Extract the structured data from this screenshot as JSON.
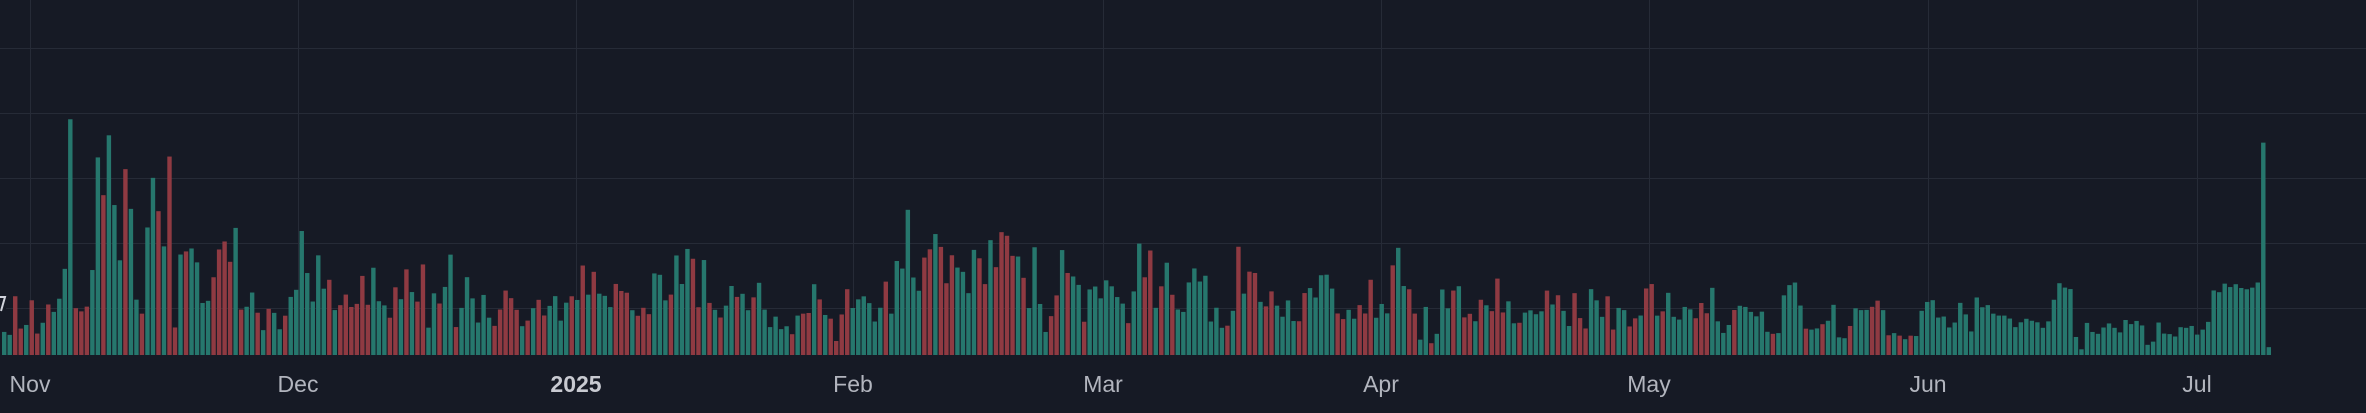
{
  "chart_data": {
    "type": "bar",
    "title": "",
    "xlabel": "",
    "ylabel": "",
    "grid": true,
    "legend": "none",
    "ylim": [
      0,
      100
    ],
    "x_ticks": [
      "Nov",
      "Dec",
      "2025",
      "Feb",
      "Mar",
      "Apr",
      "May",
      "Jun",
      "Jul"
    ],
    "bold_ticks": [
      "2025"
    ],
    "colors": {
      "up": "#26776d",
      "down": "#8f3a42",
      "background": "#161a25",
      "grid": "#262b37",
      "tick_text": "#b2b5be"
    },
    "directions": "UUDDUDDUDUUUUDDDUUDUUUDUUDUUDUDDUDUUUUDDDDUDUUDUDUUDUUUUUUUDUDDDDDDUUUDDUDUDDUUDUUDUUUUUUDDDDDUDUDDUUUUDUDUDUUUDDDUDDDUUUDUUUDDUDUDUUDUUDUUUUUUDUDDUDUDDDDUUUUUUDUUUUUUDDUDDDUUUUDDUDDDDUDUUUUDDUDUUDUUUUUUUDUUDDUDUDUUUUUUUUUDUDUDDUDDUUUUDDUUUUUDDUUDDDUUUDUUDDUUDUUUDUDDUDUDDDUUDUUUUDUDUUDDDUUUDDUUDDUDDUDUUUUUDDDUUUUDUUUUUUDUUUUUDUUDUUUUDUUUDDUDUDUDU",
    "values": [
      6.89,
      6.01,
      17.54,
      7.89,
      8.97,
      16.33,
      6.4,
      9.62,
      15.08,
      12.87,
      16.8,
      25.72,
      70.37,
      13.98,
      13.02,
      14.44,
      25.36,
      58.98,
      47.71,
      65.58,
      44.76,
      28.27,
      55.48,
      43.62,
      16.52,
      12.34,
      38.07,
      52.88,
      42.93,
      32.42,
      59.24,
      8.22,
      29.99,
      30.92,
      31.8,
      27.65,
      15.53,
      16.17,
      23.21,
      31.5,
      33.89,
      27.82,
      37.94,
      13.56,
      14.4,
      18.65,
      12.62,
      7.42,
      13.78,
      12.58,
      7.68,
      11.73,
      17.34,
      19.46,
      37.01,
      24.47,
      15.96,
      29.75,
      19.79,
      22.45,
      13.41,
      14.88,
      18.04,
      14.33,
      15.26,
      23.61,
      14.99,
      26.05,
      16.05,
      14.81,
      11.13,
      20.21,
      16.66,
      25.56,
      18.79,
      15.94,
      27.03,
      8.16,
      18.41,
      15.37,
      20.32,
      29.96,
      8.34,
      14.06,
      23.23,
      16.9,
      9.69,
      17.93,
      11.14,
      8.7,
      13.58,
      19.24,
      16.97,
      13.49,
      8.6,
      10.27,
      13.97,
      16.47,
      11.79,
      14.66,
      17.57,
      10.26,
      15.62,
      17.53,
      16.43,
      26.71,
      18.01,
      24.83,
      18.3,
      17.66,
      14.3,
      21.21,
      19.11,
      18.59,
      13.37,
      11.71,
      14.09,
      12.19,
      24.35,
      23.94,
      16.31,
      18.03,
      29.71,
      21.19,
      31.66,
      28.73,
      14.26,
      28.35,
      15.55,
      13.49,
      11.19,
      14.73,
      20.6,
      17.34,
      18.27,
      13.37,
      17.21,
      21.55,
      13.55,
      8.33,
      11.45,
      7.72,
      8.58,
      6.21,
      11.76,
      12.34,
      12.54,
      21.13,
      16.59,
      11.95,
      10.84,
      4.18,
      12.1,
      19.64,
      14.03,
      16.61,
      17.51,
      15.49,
      9.99,
      14.1,
      21.9,
      12.34,
      28.06,
      25.8,
      43.34,
      23.13,
      19.18,
      29.08,
      31.55,
      36.1,
      32.27,
      21.42,
      29.77,
      26.1,
      24.82,
      18.46,
      31.38,
      28.87,
      21.16,
      34.28,
      26.22,
      36.67,
      35.59,
      29.6,
      29.39,
      23.04,
      14.02,
      32.16,
      15.23,
      6.88,
      11.6,
      17.79,
      31.32,
      24.48,
      23.44,
      20.93,
      9.93,
      19.57,
      20.44,
      16.91,
      22.29,
      20.5,
      17.3,
      15.34,
      9.51,
      18.98,
      33.25,
      23.2,
      31.19,
      14.08,
      20.5,
      27.55,
      17.98,
      13.59,
      12.86,
      21.66,
      25.84,
      21.93,
      23.66,
      9.99,
      14.11,
      8.12,
      8.75,
      13.19,
      32.31,
      18.32,
      24.88,
      24.48,
      15.87,
      14.51,
      18.99,
      14.73,
      11.43,
      16.29,
      10.14,
      10.08,
      18.49,
      19.98,
      17.16,
      23.81,
      23.97,
      19.82,
      12.4,
      10.72,
      13.49,
      10.83,
      14.89,
      12.39,
      22.46,
      11.12,
      15.23,
      12.43,
      26.76,
      31.99,
      20.59,
      19.62,
      12.36,
      4.58,
      14.35,
      3.52,
      6.32,
      19.55,
      13.94,
      19.24,
      20.53,
      11.23,
      12.3,
      10.08,
      16.49,
      14.84,
      13.09,
      22.81,
      12.7,
      16.02,
      9.47,
      9.62,
      12.65,
      13.33,
      12.17,
      13.04,
      19.23,
      15.08,
      17.84,
      13.18,
      8.65,
      18.46,
      11.02,
      7.92,
      19.66,
      16.32,
      11.39,
      17.52,
      7.59,
      14.05,
      13.4,
      8.52,
      10.94,
      11.78,
      19.86,
      21.18,
      11.75,
      13.03,
      18.56,
      11.4,
      10.57,
      14.35,
      13.63,
      10.97,
      15.52,
      12.46,
      20.05,
      10.05,
      6.59,
      8.96,
      13.43,
      14.69,
      14.35,
      12.87,
      11.54,
      12.94,
      6.93,
      6.32,
      6.54,
      17.81,
      20.86,
      21.63,
      14.76,
      7.86,
      7.58,
      7.93,
      9.19,
      10.22,
      14.98,
      5.27,
      5.01,
      8.67,
      13.94,
      13.4,
      13.47,
      14.38,
      16.23,
      13.39,
      5.89,
      6.53,
      5.78,
      4.72,
      5.77,
      5.66,
      13.19,
      15.84,
      16.36,
      11.18,
      11.48,
      8.22,
      9.69,
      15.56,
      12.12,
      7.03,
      17.17,
      14.25,
      14.89,
      12.34,
      11.77,
      11.76,
      10.88,
      8.32,
      9.76,
      10.81,
      10.22,
      9.76,
      8.12,
      10.04,
      16.49,
      21.43,
      20.12,
      19.68,
      5.38,
      1.7,
      9.58,
      6.88,
      6.32,
      8.21,
      9.42,
      8.11,
      6.75,
      10.45,
      9.22,
      10.17,
      8.82,
      3.04,
      3.99,
      9.69,
      6.39,
      6.24,
      5.52,
      8.3,
      8.11,
      8.67,
      6.09,
      7.58,
      9.89,
      19.27,
      18.75,
      21.3,
      20.28,
      21.13,
      20.0,
      19.62,
      20.11,
      21.64,
      63.39,
      2.34
    ]
  }
}
